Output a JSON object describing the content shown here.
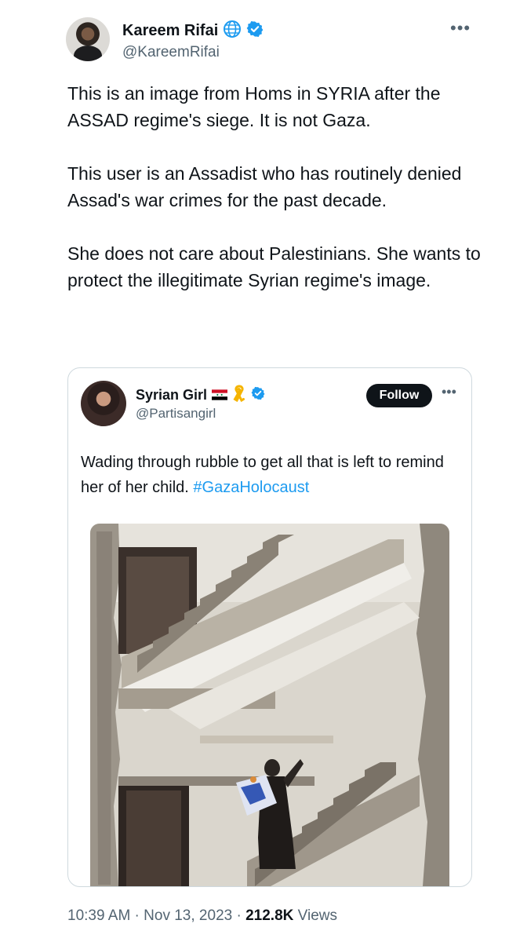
{
  "author": {
    "name": "Kareem Rifai",
    "handle": "@KareemRifai",
    "globe_icon": "globe-icon",
    "verified_icon": "verified-badge-icon"
  },
  "more_icon": "more-options-icon",
  "tweet": {
    "paragraphs": [
      "This is an image from Homs in SYRIA after the ASSAD regime's siege. It is not Gaza.",
      "This user is an Assadist who has routinely denied Assad's war crimes for the past decade.",
      "She does not care about Palestinians. She wants to protect the illegitimate Syrian regime's image."
    ]
  },
  "quoted": {
    "name": "Syrian Girl",
    "handle": "@Partisangirl",
    "follow_label": "Follow",
    "text": "Wading through rubble to get all that  is left to remind her of her child. ",
    "hashtag": "#GazaHolocaust",
    "flag_icon": "syria-flag-icon",
    "ribbon_icon": "yellow-ribbon-icon",
    "verified_icon": "verified-badge-icon"
  },
  "meta": {
    "time": "10:39 AM",
    "sep1": " · ",
    "date": "Nov 13, 2023",
    "sep2": " · ",
    "views_count": "212.8K",
    "views_label": " Views"
  },
  "colors": {
    "accent": "#1d9bf0",
    "text": "#0f1419",
    "secondary": "#536471",
    "border": "#cfd9de"
  }
}
